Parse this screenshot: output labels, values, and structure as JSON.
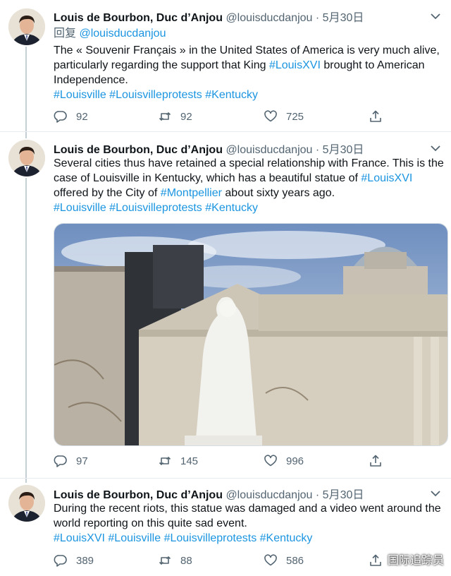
{
  "colors": {
    "link": "#1b95e0",
    "muted": "#536471",
    "thread": "#c4cfd6"
  },
  "author": {
    "name": "Louis de Bourbon, Duc d’Anjou",
    "handle": "@louisducdanjou",
    "date": "5月30日"
  },
  "tweets": [
    {
      "reply_label": "回复",
      "reply_to": "@louisducdanjou",
      "text_parts": [
        "The « Souvenir Français » in the United States of America is very much alive, particularly regarding the support that King ",
        "#LouisXVI",
        " brought to American Independence."
      ],
      "hashtags": [
        "#Louisville",
        "#Louisvilleprotests",
        "#Kentucky"
      ],
      "replies": "92",
      "retweets": "92",
      "likes": "725"
    },
    {
      "text_parts": [
        "Several cities thus have retained a special relationship with France. This is the case of Louisville in Kentucky, which has a beautiful statue of ",
        "#LouisXVI",
        " offered by the City of ",
        "#Montpellier",
        " about sixty years ago."
      ],
      "hashtags": [
        "#Louisville",
        "#Louisvilleprotests",
        "#Kentucky"
      ],
      "image_icon": "statue-photo",
      "replies": "97",
      "retweets": "145",
      "likes": "996"
    },
    {
      "text_parts": [
        "During the recent riots, this statue was damaged and a video went around the world reporting on this quite sad event."
      ],
      "hashtags": [
        "#LouisXVI",
        "#Louisville",
        "#Louisvilleprotests",
        "#Kentucky"
      ],
      "replies": "389",
      "retweets": "88",
      "likes": "586"
    }
  ],
  "watermark": "国际追踪员",
  "icons": {
    "reply": "speech-bubble-icon",
    "retweet": "retweet-arrows-icon",
    "like": "heart-icon",
    "share": "share-icon",
    "caret": "chevron-down-icon"
  }
}
